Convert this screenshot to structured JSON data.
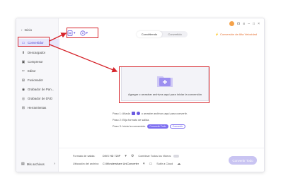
{
  "sidebar": {
    "back_label": "Inicio",
    "items": [
      {
        "label": "Convertidor",
        "icon": "convert-icon"
      },
      {
        "label": "Descargador",
        "icon": "download-icon"
      },
      {
        "label": "Compresor",
        "icon": "compress-icon"
      },
      {
        "label": "Editor",
        "icon": "scissors-icon"
      },
      {
        "label": "Fusionador",
        "icon": "merge-icon"
      },
      {
        "label": "Grabador de Pan...",
        "icon": "screen-record-icon"
      },
      {
        "label": "Grabador de DVD",
        "icon": "dvd-icon"
      },
      {
        "label": "Herramientas",
        "icon": "grid-icon"
      }
    ],
    "my_files": "Mis archivos"
  },
  "tabs": {
    "converting": "Convirtiendo",
    "converted": "Convertido",
    "active": "converting"
  },
  "fast_conversion": "Conversión de Alta Velocidad",
  "dropzone": {
    "text": "Agregar o arrastrar archivos aquí para iniciar la conversión"
  },
  "steps": {
    "step1_prefix": "Paso 1: Añada",
    "step1_suffix": "o arrastre archivos aquí para convertir.",
    "step2": "Paso 2: Elija formato de salida.",
    "step3": "Paso 3: Inicia la conversión.",
    "convert_all_pill": "Convertir Todo",
    "convert_pill": "Convertir"
  },
  "bottom": {
    "output_format_label": "Formato de salida:",
    "output_format_value": "DIVX HD 720P",
    "merge_label": "Combinar Todos los Videos",
    "file_location_label": "Ubicación del archivo:",
    "file_location_value": "C:\\Wondershare UniConverter",
    "upload_label": "Subir a Cloud",
    "convert_all_button": "Convertir Todo"
  },
  "colors": {
    "accent": "#6a5ae0",
    "annotation": "#d6232a",
    "orange": "#e56b2a"
  }
}
